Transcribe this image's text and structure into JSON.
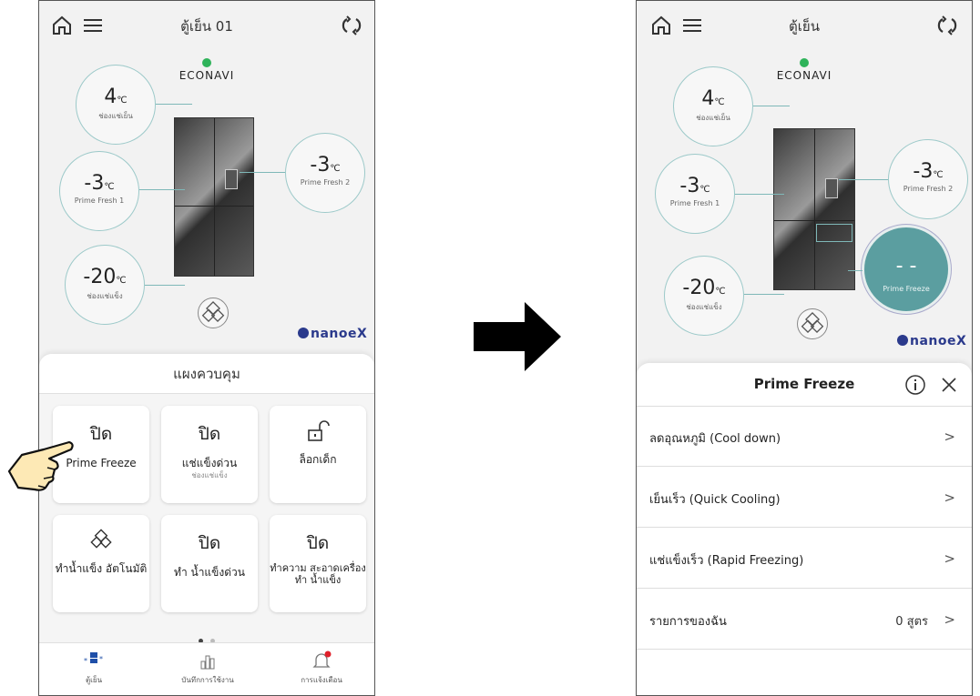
{
  "left_screen": {
    "title": "ตู้เย็น 01",
    "brand": "ECONAVI",
    "nanoe": "nanoeX",
    "zones": [
      {
        "value": "4",
        "unit": "℃",
        "label": "ช่องแช่เย็น"
      },
      {
        "value": "-3",
        "unit": "℃",
        "label": "Prime Fresh 1"
      },
      {
        "value": "-3",
        "unit": "℃",
        "label": "Prime Fresh 2"
      },
      {
        "value": "-20",
        "unit": "℃",
        "label": "ช่องแช่แข็ง"
      }
    ],
    "panel_title": "แผงควบคุม",
    "tiles": [
      {
        "status": "ปิด",
        "label": "Prime Freeze",
        "sub": ""
      },
      {
        "status": "ปิด",
        "label": "แช่แข็งด่วน",
        "sub": "ช่องแช่แข็ง"
      },
      {
        "status": "",
        "label": "ล็อกเด็ก",
        "sub": ""
      },
      {
        "status": "",
        "label": "ทำน้ำแข็ง อัตโนมัติ",
        "sub": ""
      },
      {
        "status": "ปิด",
        "label": "ทำ น้ำแข็งด่วน",
        "sub": ""
      },
      {
        "status": "ปิด",
        "label": "ทำความ สะอาดเครื่องทำ น้ำแข็ง",
        "sub": ""
      }
    ],
    "nav": [
      {
        "label": "ตู้เย็น",
        "icon": "fridge-nav-icon"
      },
      {
        "label": "บันทึกการใช้งาน",
        "icon": "bar-chart-icon"
      },
      {
        "label": "การแจ้งเตือน",
        "icon": "bell-icon"
      }
    ]
  },
  "right_screen": {
    "title": "ตู้เย็น",
    "brand": "ECONAVI",
    "nanoe": "nanoeX",
    "zones": [
      {
        "value": "4",
        "unit": "℃",
        "label": "ช่องแช่เย็น"
      },
      {
        "value": "-3",
        "unit": "℃",
        "label": "Prime Fresh 1"
      },
      {
        "value": "-3",
        "unit": "℃",
        "label": "Prime Fresh 2"
      },
      {
        "value": "-20",
        "unit": "℃",
        "label": "ช่องแช่แข็ง"
      },
      {
        "value": "- -",
        "unit": "",
        "label": "Prime Freeze"
      }
    ],
    "sheet_title": "Prime Freeze",
    "menu": [
      {
        "label": "ลดอุณหภูมิ (Cool down)",
        "value": ""
      },
      {
        "label": "เย็นเร็ว (Quick Cooling)",
        "value": ""
      },
      {
        "label": "แช่แข็งเร็ว (Rapid Freezing)",
        "value": ""
      },
      {
        "label": "รายการของฉัน",
        "value": "0 สูตร"
      }
    ]
  },
  "colors": {
    "teal": "#5b9ea0",
    "ring": "#9cc9c9",
    "nanoe": "#2b3a8c",
    "econavi_leaf": "#2fb35a",
    "notify": "#e0202a"
  }
}
